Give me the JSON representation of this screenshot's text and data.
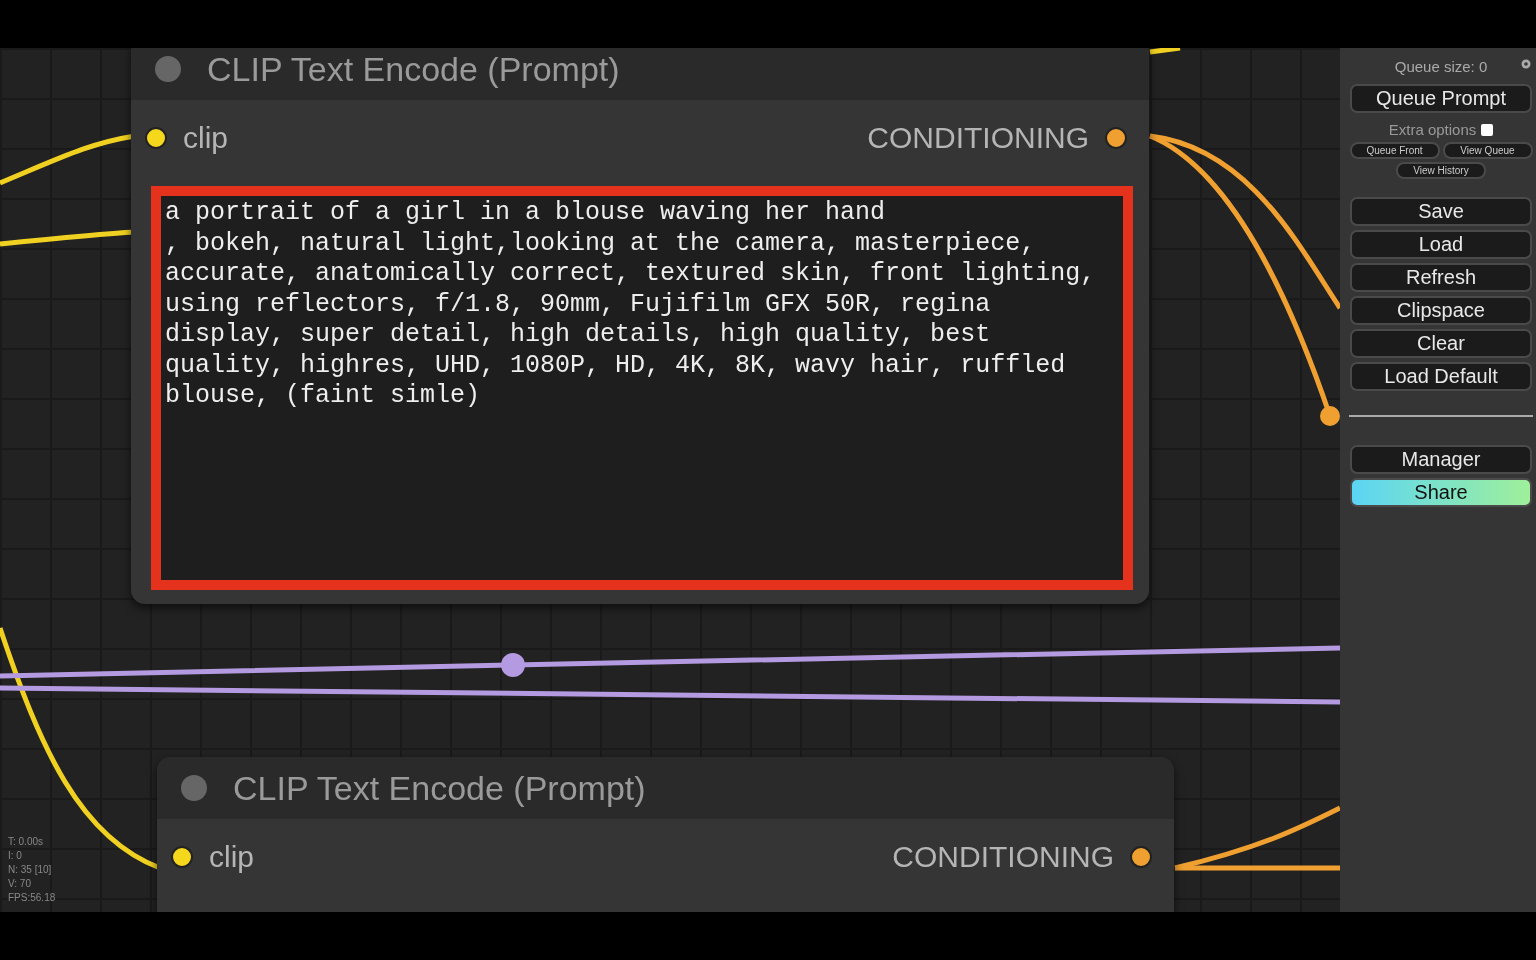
{
  "nodes": [
    {
      "title": "CLIP Text Encode (Prompt)",
      "input": "clip",
      "output": "CONDITIONING",
      "text": "a portrait of a girl in a blouse waving her hand\n, bokeh, natural light,looking at the camera, masterpiece, accurate, anatomically correct, textured skin, front lighting, using reflectors, f/1.8, 90mm, Fujifilm GFX 50R, regina display, super detail, high details, high quality, best quality, highres, UHD, 1080P, HD, 4K, 8K, wavy hair, ruffled blouse, (faint simle)"
    },
    {
      "title": "CLIP Text Encode (Prompt)",
      "input": "clip",
      "output": "CONDITIONING"
    }
  ],
  "stats": [
    "T: 0.00s",
    "I: 0",
    "N: 35 [10]",
    "V: 70",
    "FPS:56.18"
  ],
  "sidebar": {
    "queue_size": "Queue size: 0",
    "queue_button": "Queue Prompt",
    "extra_options": {
      "label": "Extra options",
      "checked": false
    },
    "small_buttons": [
      "Queue Front",
      "View Queue",
      "View History"
    ],
    "buttons": [
      "Save",
      "Load",
      "Refresh",
      "Clipspace",
      "Clear",
      "Load Default"
    ],
    "extra_buttons": [
      {
        "label": "Manager",
        "kind": "plain"
      },
      {
        "label": "Share",
        "kind": "gradient"
      }
    ]
  }
}
